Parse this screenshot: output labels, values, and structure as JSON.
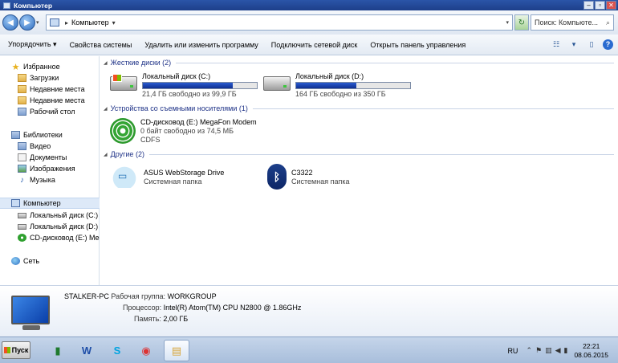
{
  "window": {
    "title": "Компьютер"
  },
  "address": {
    "crumb": "Компьютер",
    "search_placeholder": "Поиск: Компьюте..."
  },
  "toolbar": {
    "items": [
      "Упорядочить ▾",
      "Свойства системы",
      "Удалить или изменить программу",
      "Подключить сетевой диск",
      "Открыть панель управления"
    ]
  },
  "nav": {
    "favorites": "Избранное",
    "downloads": "Загрузки",
    "recent": "Недавние места",
    "recent2": "Недавние места",
    "desktop": "Рабочий стол",
    "libraries": "Библиотеки",
    "video": "Видео",
    "documents": "Документы",
    "images": "Изображения",
    "music": "Музыка",
    "computer": "Компьютер",
    "disk_c": "Локальный диск (C:)",
    "disk_d": "Локальный диск (D:)",
    "cd": "CD-дисковод (E:) Mega",
    "network": "Сеть"
  },
  "groups": {
    "hdd": "Жесткие диски (2)",
    "removable": "Устройства со съемными носителями (1)",
    "other": "Другие (2)"
  },
  "drives": [
    {
      "name": "Локальный диск (C:)",
      "free": "21,4 ГБ свободно из 99,9 ГБ",
      "used_fraction": 0.79
    },
    {
      "name": "Локальный диск (D:)",
      "free": "164 ГБ свободно из 350 ГБ",
      "used_fraction": 0.53
    }
  ],
  "cd": {
    "name": "CD-дисковод (E:) MegaFon Modem",
    "free": "0 байт свободно из 74,5 МБ",
    "fs": "CDFS"
  },
  "others": [
    {
      "name": "ASUS WebStorage Drive",
      "type": "Системная папка"
    },
    {
      "name": "C3322",
      "type": "Системная папка"
    }
  ],
  "details": {
    "pc_name": "STALKER-PC",
    "workgroup_label": "Рабочая группа:",
    "workgroup": "WORKGROUP",
    "cpu_label": "Процессор:",
    "cpu": "Intel(R) Atom(TM) CPU N2800  @ 1.86GHz",
    "mem_label": "Память:",
    "mem": "2,00 ГБ"
  },
  "taskbar": {
    "start": "Пуск",
    "lang": "RU",
    "time": "22:21",
    "date": "08.06.2015"
  },
  "colors": {
    "titlebar": "#1d3f8a",
    "accent": "#1e3287",
    "bar_fill": "#0f2f90"
  }
}
